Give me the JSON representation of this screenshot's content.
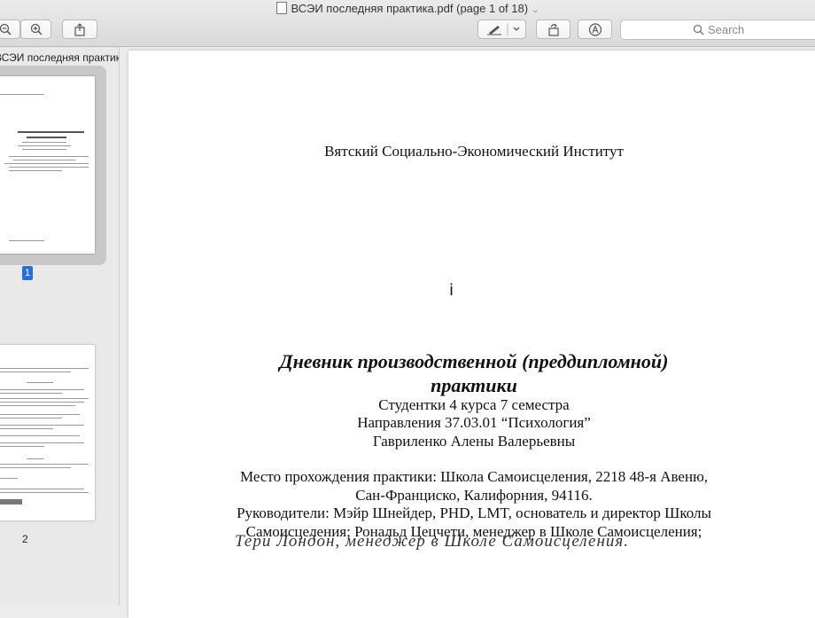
{
  "window": {
    "title": "ВСЭИ последняя практика.pdf (page 1 of 18)"
  },
  "toolbar": {
    "zoom_out_icon": "zoom-out-icon",
    "zoom_in_icon": "zoom-in-icon",
    "share_icon": "share-icon",
    "markup_icon": "pen-icon",
    "rotate_icon": "rotate-icon",
    "annotate_icon": "markup-circle-icon",
    "search_placeholder": "Search"
  },
  "sidebar": {
    "file_name": "ВСЭИ последняя практика.pdf",
    "pages": [
      {
        "number": "1",
        "selected": true
      },
      {
        "number": "2",
        "selected": false
      }
    ]
  },
  "document": {
    "institute": "Вятский Социально-Экономический Институт",
    "mark": "ⅰ",
    "title_line1": "Дневник производственной (преддипломной)",
    "title_line2": "практики",
    "student_course": "Студентки 4 курса 7 семестра",
    "direction": "Направления 37.03.01 “Психология”",
    "student_name": "Гавриленко Алены Валерьевны",
    "place_line1": "Место прохождения практики: Школа Самоисцеления, 2218 48-я Авеню,",
    "place_line2": "Сан-Франциско, Калифорния, 94116.",
    "supervisors_line1": "Руководители: Мэйр Шнейдер, PHD, LMT, основатель и директор Школы",
    "supervisors_line2": "Самоисцеления; Рональд Цецчети, менеджер в Школе Самоисцеления;",
    "handwritten": "Тери Лондон, менеджер в Школе Самоисцеления."
  }
}
